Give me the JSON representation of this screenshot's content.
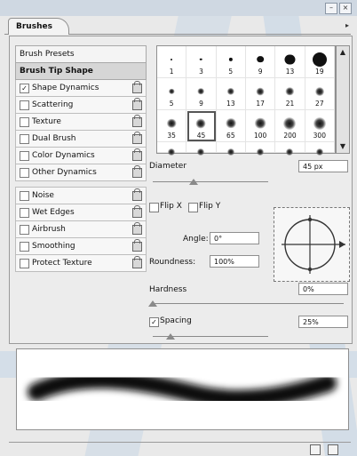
{
  "window": {
    "minimize_label": "–",
    "close_label": "×"
  },
  "tab": {
    "label": "Brushes"
  },
  "left_panel": {
    "brush_presets": "Brush Presets",
    "brush_tip_shape": "Brush Tip Shape",
    "group1": [
      {
        "label": "Shape Dynamics",
        "checked": true
      },
      {
        "label": "Scattering",
        "checked": false
      },
      {
        "label": "Texture",
        "checked": false
      },
      {
        "label": "Dual Brush",
        "checked": false
      },
      {
        "label": "Color Dynamics",
        "checked": false
      },
      {
        "label": "Other Dynamics",
        "checked": false
      }
    ],
    "group2": [
      {
        "label": "Noise",
        "checked": false
      },
      {
        "label": "Wet Edges",
        "checked": false
      },
      {
        "label": "Airbrush",
        "checked": false
      },
      {
        "label": "Smoothing",
        "checked": false
      },
      {
        "label": "Protect Texture",
        "checked": false
      }
    ]
  },
  "presets": {
    "rows": [
      [
        "1",
        "3",
        "5",
        "9",
        "13",
        "19"
      ],
      [
        "5",
        "9",
        "13",
        "17",
        "21",
        "27"
      ],
      [
        "35",
        "45",
        "65",
        "100",
        "200",
        "300"
      ]
    ],
    "selected": "45"
  },
  "controls": {
    "diameter_label": "Diameter",
    "diameter_value": "45 px",
    "diameter_fraction": 0.35,
    "flip_x_label": "Flip X",
    "flip_y_label": "Flip Y",
    "angle_label": "Angle:",
    "angle_value": "0°",
    "roundness_label": "Roundness:",
    "roundness_value": "100%",
    "hardness_label": "Hardness",
    "hardness_value": "0%",
    "hardness_fraction": 0.0,
    "spacing_label": "Spacing",
    "spacing_checked": true,
    "spacing_value": "25%",
    "spacing_fraction": 0.15
  }
}
